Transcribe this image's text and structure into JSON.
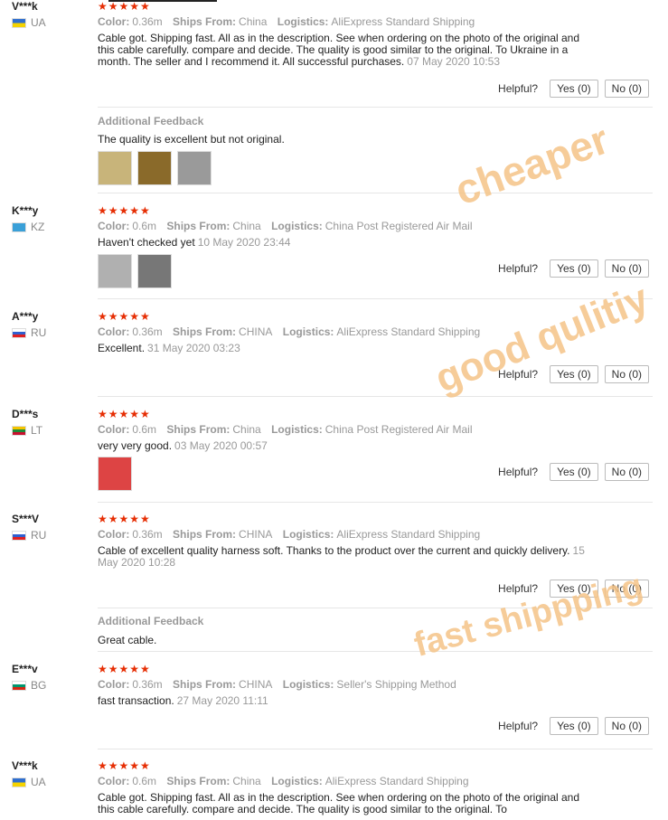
{
  "reviews": [
    {
      "user": "V***k",
      "country": "UA",
      "stars": "★★★★★",
      "color": "0.36m",
      "ships_from": "China",
      "logistics": "AliExpress Standard Shipping",
      "text": "Cable got. Shipping fast. All as in the description. See when ordering on the photo of the original and this cable carefully. compare and decide. The quality is good similar to the original. To Ukraine in a month. The seller and I recommend it. All successful purchases.",
      "date": "07 May 2020 10:53",
      "helpful": "Helpful?",
      "yes": "Yes (0)",
      "no": "No (0)",
      "additional_title": "Additional Feedback",
      "additional_text": "The quality is excellent but not original."
    },
    {
      "user": "K***y",
      "country": "KZ",
      "stars": "★★★★★",
      "color": "0.6m",
      "ships_from": "China",
      "logistics": "China Post Registered Air Mail",
      "text": "Haven't checked yet",
      "date": "10 May 2020 23:44",
      "helpful": "Helpful?",
      "yes": "Yes (0)",
      "no": "No (0)"
    },
    {
      "user": "A***y",
      "country": "RU",
      "stars": "★★★★★",
      "color": "0.36m",
      "ships_from": "CHINA",
      "logistics": "AliExpress Standard Shipping",
      "text": "Excellent.",
      "date": "31 May 2020 03:23",
      "helpful": "Helpful?",
      "yes": "Yes (0)",
      "no": "No (0)"
    },
    {
      "user": "D***s",
      "country": "LT",
      "stars": "★★★★★",
      "color": "0.6m",
      "ships_from": "China",
      "logistics": "China Post Registered Air Mail",
      "text": "very very good.",
      "date": "03 May 2020 00:57",
      "helpful": "Helpful?",
      "yes": "Yes (0)",
      "no": "No (0)"
    },
    {
      "user": "S***V",
      "country": "RU",
      "stars": "★★★★★",
      "color": "0.36m",
      "ships_from": "CHINA",
      "logistics": "AliExpress Standard Shipping",
      "text": "Cable of excellent quality harness soft. Thanks to the product over the current and quickly delivery.",
      "date": "15 May 2020 10:28",
      "helpful": "Helpful?",
      "yes": "Yes (0)",
      "no": "No (0)",
      "additional_title": "Additional Feedback",
      "additional_text": "Great cable."
    },
    {
      "user": "E***v",
      "country": "BG",
      "stars": "★★★★★",
      "color": "0.36m",
      "ships_from": "CHINA",
      "logistics": "Seller's Shipping Method",
      "text": "fast transaction.",
      "date": "27 May 2020 11:11",
      "helpful": "Helpful?",
      "yes": "Yes (0)",
      "no": "No (0)"
    },
    {
      "user": "V***k",
      "country": "UA",
      "stars": "★★★★★",
      "color": "0.6m",
      "ships_from": "China",
      "logistics": "AliExpress Standard Shipping",
      "text": "Cable got. Shipping fast. All as in the description. See when ordering on the photo of the original and this cable carefully. compare and decide. The quality is good similar to the original. To",
      "date": ""
    }
  ],
  "labels": {
    "color": "Color:",
    "ships_from": "Ships From:",
    "logistics": "Logistics:"
  },
  "watermarks": {
    "cheaper": "cheaper",
    "good": "good qulitiy",
    "fast": "fast shippping"
  },
  "colors": {
    "star": "#e62e04",
    "watermark": "#f5c488"
  }
}
